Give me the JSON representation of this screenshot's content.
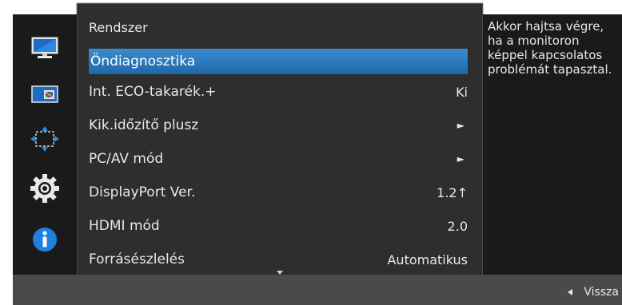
{
  "menu": {
    "title": "Rendszer",
    "items": [
      {
        "label": "Öndiagnosztika",
        "value": "",
        "arrow": false,
        "selected": true
      },
      {
        "label": "Int. ECO-takarék.+",
        "value": "Ki",
        "arrow": false,
        "selected": false
      },
      {
        "label": "Kik.időzítő plusz",
        "value": "",
        "arrow": true,
        "selected": false
      },
      {
        "label": "PC/AV mód",
        "value": "",
        "arrow": true,
        "selected": false
      },
      {
        "label": "DisplayPort Ver.",
        "value": "1.2↑",
        "arrow": false,
        "selected": false
      },
      {
        "label": "HDMI mód",
        "value": "2.0",
        "arrow": false,
        "selected": false
      },
      {
        "label": "Forrásészlelés",
        "value": "Automatikus",
        "arrow": false,
        "selected": false
      }
    ],
    "arrow_glyph": "►"
  },
  "sidebar": {
    "icons": [
      "monitor-icon",
      "picture-in-picture-icon",
      "resize-arrows-icon",
      "gear-icon",
      "info-icon"
    ]
  },
  "description": {
    "text": "Akkor hajtsa végre, ha a monitoron képpel kapcsolatos problémát tapasztal."
  },
  "footer": {
    "back_label": "Vissza"
  },
  "colors": {
    "selected_row": "#2c7abe",
    "panel_bg": "#2e2e2e",
    "side_bg": "#1a1a1a",
    "footer_bg": "#4a4a4a"
  }
}
